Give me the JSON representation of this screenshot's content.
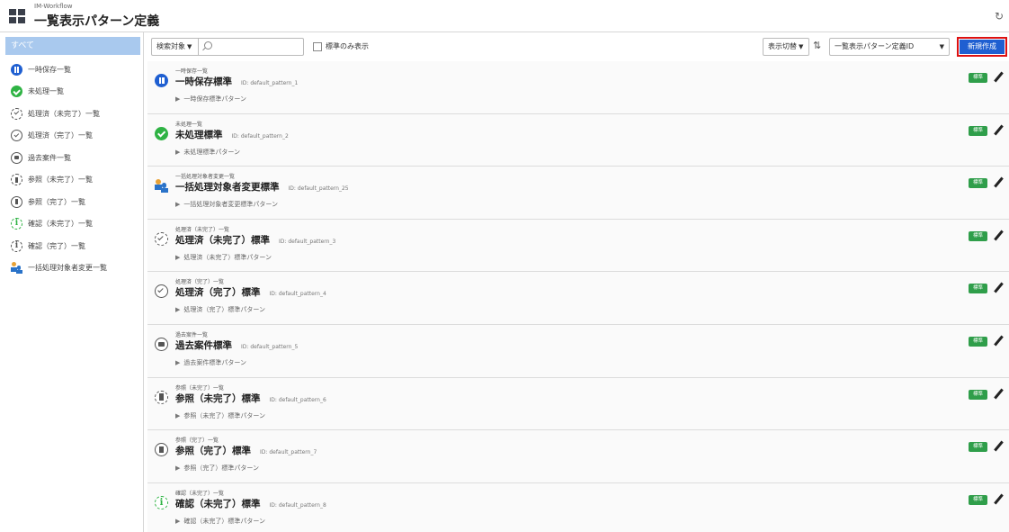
{
  "header": {
    "app_sub": "IM-Workflow",
    "title": "一覧表示パターン定義",
    "refresh_icon": "refresh-icon"
  },
  "sidebar": {
    "all_label": "すべて",
    "items": [
      {
        "label": "一時保存一覧",
        "icon": "pause-circle-icon"
      },
      {
        "label": "未処理一覧",
        "icon": "check-circle-icon"
      },
      {
        "label": "処理済（未完了）一覧",
        "icon": "dashed-check-circle-icon"
      },
      {
        "label": "処理済（完了）一覧",
        "icon": "check-circle-outline-icon"
      },
      {
        "label": "過去案件一覧",
        "icon": "folder-circle-icon"
      },
      {
        "label": "参照（未完了）一覧",
        "icon": "dashed-document-circle-icon"
      },
      {
        "label": "参照（完了）一覧",
        "icon": "document-circle-icon"
      },
      {
        "label": "確認（未完了）一覧",
        "icon": "dashed-info-circle-icon"
      },
      {
        "label": "確認（完了）一覧",
        "icon": "info-circle-icon"
      },
      {
        "label": "一括処理対象者変更一覧",
        "icon": "people-icon"
      }
    ]
  },
  "toolbar": {
    "search_type": "検索対象",
    "search_placeholder": "",
    "standard_only_label": "標準のみ表示",
    "view_switch": "表示切替",
    "sort_field": "一覧表示パターン定義ID",
    "new_button": "新規作成"
  },
  "rows": [
    {
      "category": "一時保存一覧",
      "title": "一時保存標準",
      "id": "ID: default_pattern_1",
      "desc": "一時保存標準パターン",
      "badge": "標準"
    },
    {
      "category": "未処理一覧",
      "title": "未処理標準",
      "id": "ID: default_pattern_2",
      "desc": "未処理標準パターン",
      "badge": "標準"
    },
    {
      "category": "一括処理対象者変更一覧",
      "title": "一括処理対象者変更標準",
      "id": "ID: default_pattern_25",
      "desc": "一括処理対象者変更標準パターン",
      "badge": "標準"
    },
    {
      "category": "処理済（未完了）一覧",
      "title": "処理済（未完了）標準",
      "id": "ID: default_pattern_3",
      "desc": "処理済（未完了）標準パターン",
      "badge": "標準"
    },
    {
      "category": "処理済（完了）一覧",
      "title": "処理済（完了）標準",
      "id": "ID: default_pattern_4",
      "desc": "処理済（完了）標準パターン",
      "badge": "標準"
    },
    {
      "category": "過去案件一覧",
      "title": "過去案件標準",
      "id": "ID: default_pattern_5",
      "desc": "過去案件標準パターン",
      "badge": "標準"
    },
    {
      "category": "参照（未完了）一覧",
      "title": "参照（未完了）標準",
      "id": "ID: default_pattern_6",
      "desc": "参照（未完了）標準パターン",
      "badge": "標準"
    },
    {
      "category": "参照（完了）一覧",
      "title": "参照（完了）標準",
      "id": "ID: default_pattern_7",
      "desc": "参照（完了）標準パターン",
      "badge": "標準"
    },
    {
      "category": "確認（未完了）一覧",
      "title": "確認（未完了）標準",
      "id": "ID: default_pattern_8",
      "desc": "確認（未完了）標準パターン",
      "badge": "標準"
    }
  ]
}
